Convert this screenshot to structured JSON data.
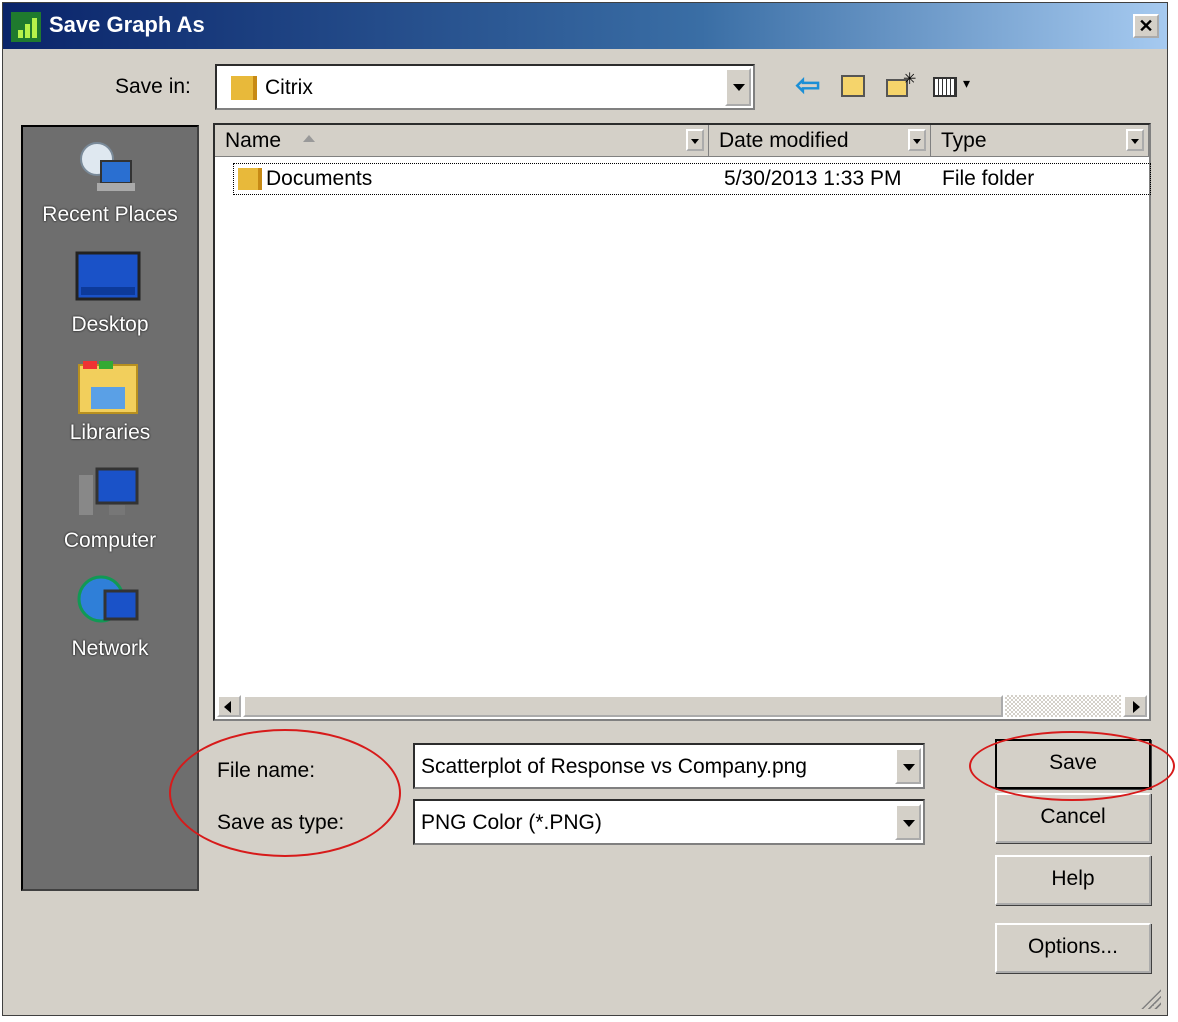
{
  "window": {
    "title": "Save Graph As",
    "close_glyph": "✕"
  },
  "save_in": {
    "label": "Save in:",
    "value": "Citrix"
  },
  "toolbar": {
    "back_glyph": "⇦",
    "new_folder_glyph": "✳",
    "view_glyph": "▾"
  },
  "places": [
    {
      "label": "Recent Places",
      "icon": "recent-places-icon"
    },
    {
      "label": "Desktop",
      "icon": "desktop-icon"
    },
    {
      "label": "Libraries",
      "icon": "libraries-icon"
    },
    {
      "label": "Computer",
      "icon": "computer-icon"
    },
    {
      "label": "Network",
      "icon": "network-icon"
    }
  ],
  "columns": [
    {
      "label": "Name"
    },
    {
      "label": "Date modified"
    },
    {
      "label": "Type"
    }
  ],
  "files": [
    {
      "name": "Documents",
      "date": "5/30/2013 1:33 PM",
      "type": "File folder"
    }
  ],
  "form": {
    "file_name_label": "File name:",
    "file_name_value": "Scatterplot of Response vs Company.png",
    "save_type_label": "Save as type:",
    "save_type_value": "PNG Color (*.PNG)"
  },
  "buttons": {
    "save": "Save",
    "cancel": "Cancel",
    "help": "Help",
    "options": "Options..."
  },
  "colors": {
    "annotation": "#d71a1a",
    "title_bar": "#0a246a",
    "dialog_bg": "#d4d0c8"
  }
}
